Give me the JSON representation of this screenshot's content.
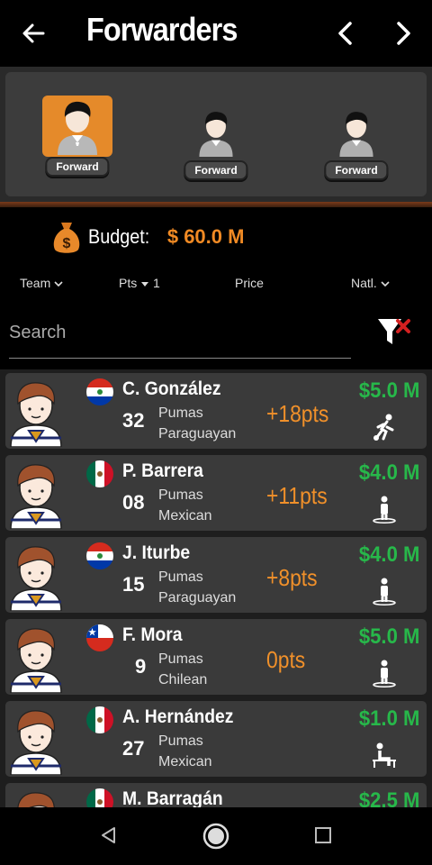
{
  "header": {
    "title": "Forwarders",
    "back_icon": "arrow-left-icon",
    "prev_icon": "chevron-left-icon",
    "next_icon": "chevron-right-icon"
  },
  "slots": [
    {
      "label": "Forward",
      "active": true
    },
    {
      "label": "Forward",
      "active": false
    },
    {
      "label": "Forward",
      "active": false
    }
  ],
  "budget": {
    "label": "Budget:",
    "value": "$ 60.0 M",
    "icon": "money-bag-icon"
  },
  "sort": {
    "team": "Team",
    "pts": "Pts",
    "pts_order": "1",
    "price": "Price",
    "natl": "Natl."
  },
  "search": {
    "placeholder": "Search",
    "value": ""
  },
  "players": [
    {
      "name": "C. González",
      "number": "32",
      "team": "Pumas",
      "nationality": "Paraguayan",
      "pts": "+18pts",
      "price": "$5.0 M",
      "flag": "paraguay",
      "status": "running-icon"
    },
    {
      "name": "P. Barrera",
      "number": "08",
      "team": "Pumas",
      "nationality": "Mexican",
      "pts": "+11pts",
      "price": "$4.0 M",
      "flag": "mexico",
      "status": "standing-icon"
    },
    {
      "name": "J. Iturbe",
      "number": "15",
      "team": "Pumas",
      "nationality": "Paraguayan",
      "pts": "+8pts",
      "price": "$4.0 M",
      "flag": "paraguay",
      "status": "standing-icon"
    },
    {
      "name": "F. Mora",
      "number": "9",
      "team": "Pumas",
      "nationality": "Chilean",
      "pts": "0pts",
      "price": "$5.0 M",
      "flag": "chile",
      "status": "standing-icon"
    },
    {
      "name": "A. Hernández",
      "number": "27",
      "team": "Pumas",
      "nationality": "Mexican",
      "pts": "",
      "price": "$1.0 M",
      "flag": "mexico",
      "status": "bench-icon"
    },
    {
      "name": "M. Barragán",
      "number": "",
      "team": "",
      "nationality": "",
      "pts": "",
      "price": "$2.5 M",
      "flag": "mexico",
      "status": ""
    }
  ],
  "colors": {
    "accent_orange": "#f08a24",
    "price_green": "#27b84a",
    "card_bg": "#3a3a3a"
  }
}
